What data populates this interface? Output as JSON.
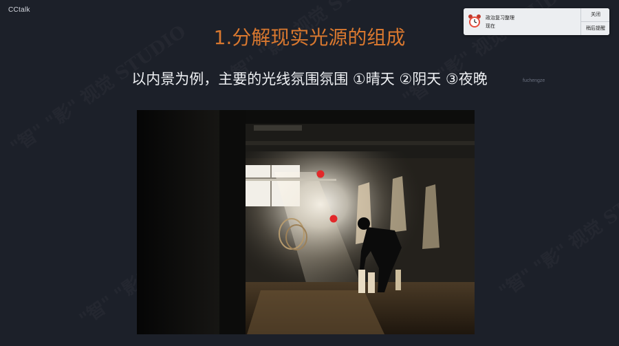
{
  "app": {
    "title": "CCtalk"
  },
  "slide": {
    "title": "1.分解现实光源的组成",
    "subtitle": "以内景为例，主要的光线氛围氛围 ①晴天 ②阴天 ③夜晚",
    "presenter_tag": "fuchengze",
    "title_color": "#d9782f"
  },
  "watermark": {
    "text": "\"智\" \"影\" 视觉 STUDIO"
  },
  "notification": {
    "title": "政治复习整理",
    "time": "现在",
    "close_label": "关闭",
    "snooze_label": "稍后提醒",
    "icon": "alarm-clock-icon"
  },
  "photo": {
    "icon": "photo-image",
    "markers": [
      "red-dot",
      "red-dot"
    ]
  }
}
